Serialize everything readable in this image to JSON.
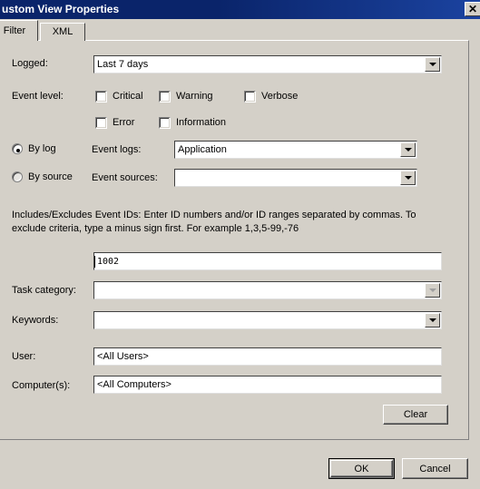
{
  "window": {
    "title": "ustom View Properties",
    "close_icon": "close-icon",
    "close_glyph": "✕"
  },
  "tabs": [
    {
      "label": "Filter",
      "active": true
    },
    {
      "label": "XML",
      "active": false
    }
  ],
  "filter": {
    "logged": {
      "label": "Logged:",
      "value": "Last 7 days",
      "arrow_icon": "chevron-down-icon"
    },
    "event_level": {
      "label": "Event level:",
      "options": [
        {
          "label": "Critical",
          "checked": false
        },
        {
          "label": "Warning",
          "checked": false
        },
        {
          "label": "Verbose",
          "checked": false
        },
        {
          "label": "Error",
          "checked": false
        },
        {
          "label": "Information",
          "checked": false
        }
      ]
    },
    "source_mode": {
      "by_log": {
        "label": "By log",
        "selected": true
      },
      "by_source": {
        "label": "By source",
        "selected": false
      }
    },
    "event_logs": {
      "label": "Event logs:",
      "value": "Application",
      "arrow_icon": "chevron-down-icon",
      "enabled": true
    },
    "event_sources": {
      "label": "Event sources:",
      "value": "",
      "arrow_icon": "chevron-down-icon",
      "enabled": false
    },
    "event_ids": {
      "help_text": "Includes/Excludes Event IDs: Enter ID numbers and/or ID ranges separated by commas. To exclude criteria, type a minus sign first. For example 1,3,5-99,-76",
      "value": "1002"
    },
    "task_category": {
      "label": "Task category:",
      "value": "",
      "arrow_icon": "chevron-down-icon",
      "enabled": false
    },
    "keywords": {
      "label": "Keywords:",
      "value": "",
      "arrow_icon": "chevron-down-icon",
      "enabled": true
    },
    "user": {
      "label": "User:",
      "value": "<All Users>"
    },
    "computers": {
      "label": "Computer(s):",
      "value": "<All Computers>"
    },
    "clear_button": "Clear"
  },
  "footer": {
    "ok": "OK",
    "cancel": "Cancel"
  },
  "colors": {
    "titlebar": "#0a246a",
    "dialog_face": "#d4d0c8",
    "field_bg": "#ffffff",
    "text": "#000000"
  }
}
